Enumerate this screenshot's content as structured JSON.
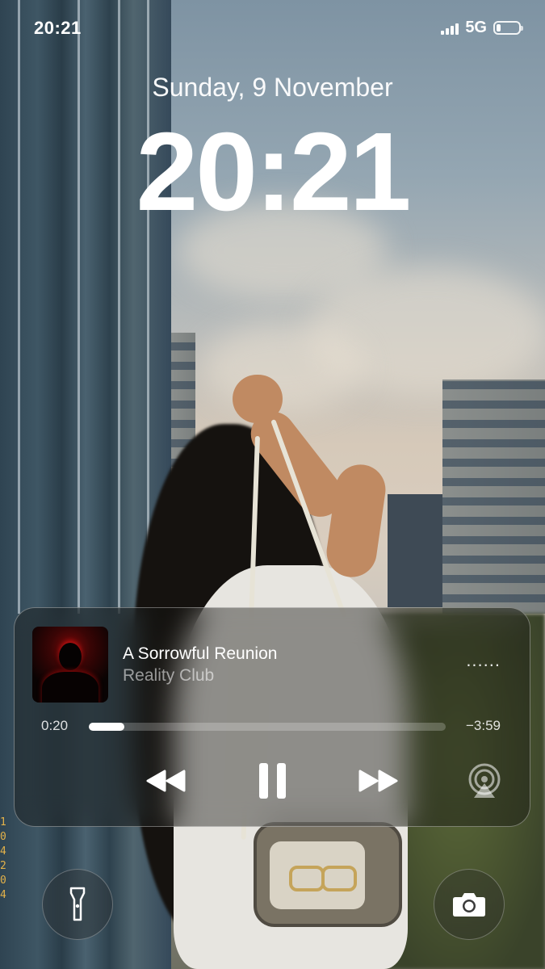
{
  "status_bar": {
    "time": "20:21",
    "network": "5G",
    "signal_bars": 4,
    "battery_level": 0.3,
    "icons": [
      "signal-icon",
      "battery-icon"
    ]
  },
  "lock_screen": {
    "date": "Sunday, 9 November",
    "time": "20:21"
  },
  "now_playing": {
    "title": "A Sorrowful Reunion",
    "artist": "Reality Club",
    "elapsed": "0:20",
    "remaining": "−3:59",
    "progress": 0.1,
    "more_label": "......",
    "controls": [
      "rewind-icon",
      "pause-icon",
      "fast-forward-icon",
      "airplay-icon"
    ]
  },
  "quick_actions": {
    "left": "flashlight-icon",
    "right": "camera-icon"
  },
  "wallpaper": {
    "film_marks": "1 0 4 2 0 4"
  },
  "colors": {
    "text": "#ffffff",
    "widget_background": "rgba(20,18,16,0.42)"
  }
}
